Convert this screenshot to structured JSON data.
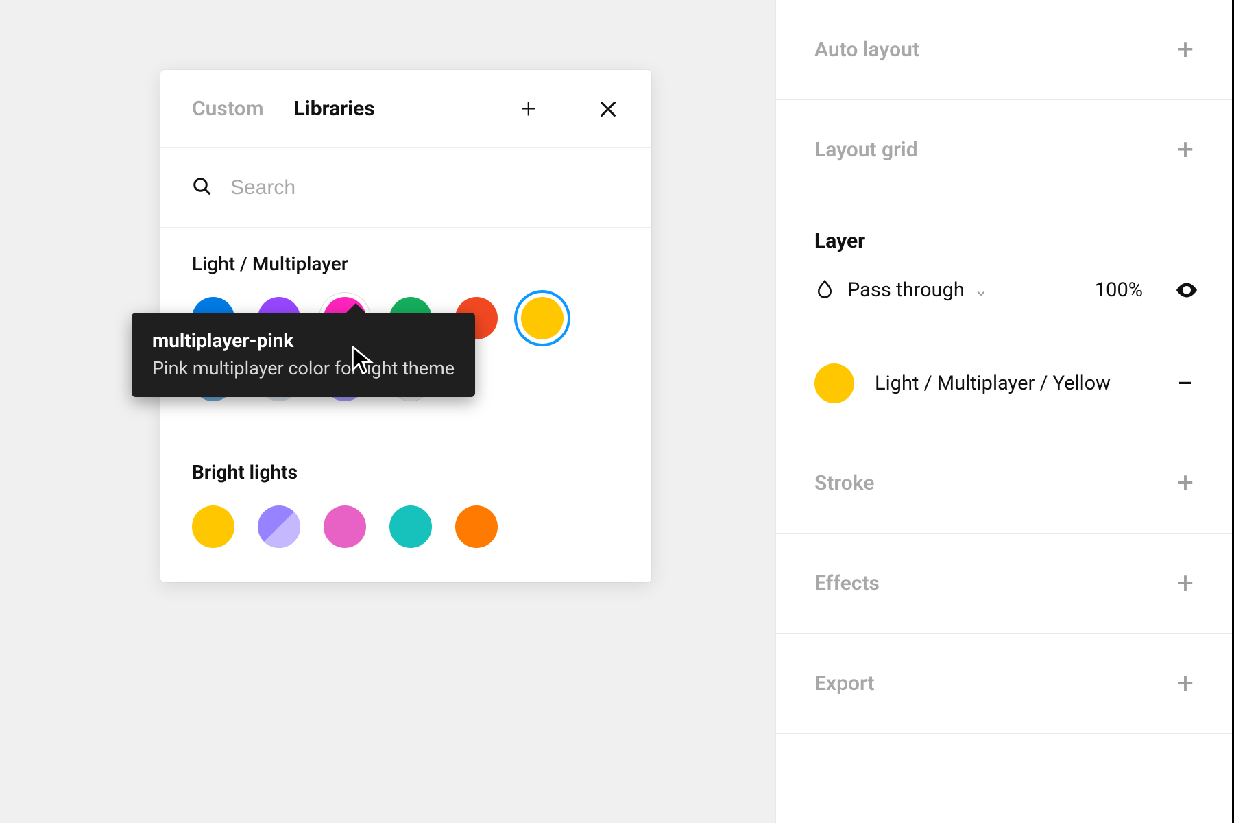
{
  "inspector": {
    "autolayout": "Auto layout",
    "layoutgrid": "Layout grid",
    "layer_label": "Layer",
    "blend_mode": "Pass through",
    "opacity": "100%",
    "fill_color": "#ffc700",
    "fill_name": "Light / Multiplayer / Yellow",
    "stroke": "Stroke",
    "effects": "Effects",
    "export": "Export"
  },
  "palette": {
    "tabs": {
      "custom": "Custom",
      "libraries": "Libraries"
    },
    "search_placeholder": "Search",
    "group1": {
      "title": "Light / Multiplayer",
      "row1": [
        {
          "name": "mp-blue",
          "color": "#007be5"
        },
        {
          "name": "mp-purple",
          "color": "#9747ff"
        },
        {
          "name": "mp-pink",
          "color": "#ff24bd",
          "hover": true
        },
        {
          "name": "mp-green",
          "color": "#14ae5c"
        },
        {
          "name": "mp-red",
          "color": "#f24822"
        },
        {
          "name": "mp-yellow",
          "color": "#ffc700",
          "selected": true
        }
      ],
      "row2": [
        {
          "name": "mix-blue",
          "half": true,
          "a": "#0d99ff",
          "b": "#6aa8d6"
        },
        {
          "name": "mix-light",
          "half": true,
          "a": "#b8d4e6",
          "b": "#d6e4ee"
        },
        {
          "name": "mix-violet",
          "half": true,
          "a": "#6b62f8",
          "b": "#a49cff"
        },
        {
          "name": "mix-bw",
          "half": true,
          "a": "#111111",
          "b": "#eeeeee"
        }
      ]
    },
    "group2": {
      "title": "Bright lights",
      "row1": [
        {
          "name": "bl-yellow",
          "color": "#ffc700"
        },
        {
          "name": "bl-purple",
          "half": true,
          "a": "#9783ff",
          "b": "#c6b8ff"
        },
        {
          "name": "bl-pink",
          "color": "#e762c4"
        },
        {
          "name": "bl-teal",
          "color": "#17c1bc"
        },
        {
          "name": "bl-orange",
          "color": "#ff7a00"
        }
      ]
    }
  },
  "tooltip": {
    "title": "multiplayer-pink",
    "desc": "Pink multiplayer color for light theme"
  }
}
